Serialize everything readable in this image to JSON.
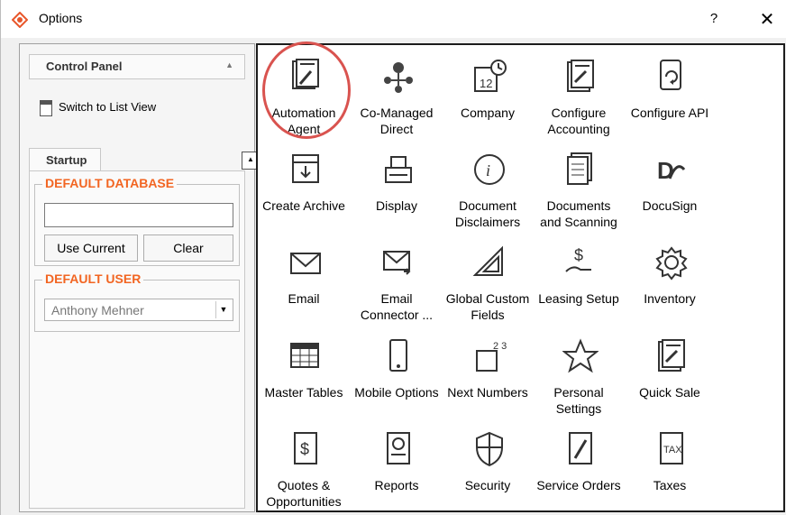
{
  "window": {
    "title": "Options",
    "help_label": "?",
    "close_label": "✕"
  },
  "left": {
    "control_panel": "Control Panel",
    "switch_view": "Switch to List View",
    "startup_tab": "Startup",
    "default_database": {
      "legend": "DEFAULT DATABASE",
      "value": "",
      "use_current": "Use Current",
      "clear": "Clear"
    },
    "default_user": {
      "legend": "DEFAULT USER",
      "selected": "Anthony Mehner"
    }
  },
  "accent_color": "#f26522",
  "highlight_color": "#d9534f",
  "tiles": [
    {
      "label1": "Automation",
      "label2": "Agent",
      "icon": "automation-agent-icon"
    },
    {
      "label1": "Co-Managed",
      "label2": "Direct",
      "icon": "network-icon"
    },
    {
      "label1": "Company",
      "label2": "",
      "icon": "calendar-clock-icon"
    },
    {
      "label1": "Configure",
      "label2": "Accounting",
      "icon": "ledger-icon"
    },
    {
      "label1": "Configure API",
      "label2": "",
      "icon": "api-sync-icon"
    },
    {
      "label1": "Create Archive",
      "label2": "",
      "icon": "archive-icon"
    },
    {
      "label1": "Display",
      "label2": "",
      "icon": "register-icon"
    },
    {
      "label1": "Document",
      "label2": "Disclaimers",
      "icon": "info-icon"
    },
    {
      "label1": "Documents",
      "label2": "and Scanning",
      "icon": "documents-icon"
    },
    {
      "label1": "DocuSign",
      "label2": "",
      "icon": "docusign-icon"
    },
    {
      "label1": "Email",
      "label2": "",
      "icon": "envelope-icon"
    },
    {
      "label1": "Email",
      "label2": "Connector ...",
      "icon": "email-connector-icon"
    },
    {
      "label1": "Global Custom",
      "label2": "Fields",
      "icon": "drafting-icon"
    },
    {
      "label1": "Leasing Setup",
      "label2": "",
      "icon": "money-hand-icon"
    },
    {
      "label1": "Inventory",
      "label2": "",
      "icon": "gear-icon"
    },
    {
      "label1": "Master Tables",
      "label2": "",
      "icon": "table-icon"
    },
    {
      "label1": "Mobile Options",
      "label2": "",
      "icon": "mobile-icon"
    },
    {
      "label1": "Next Numbers",
      "label2": "",
      "icon": "numbers-icon"
    },
    {
      "label1": "Personal",
      "label2": "Settings",
      "icon": "star-icon"
    },
    {
      "label1": "Quick Sale",
      "label2": "",
      "icon": "quick-sale-icon"
    },
    {
      "label1": "Quotes &",
      "label2": "Opportunities",
      "icon": "quote-dollar-icon"
    },
    {
      "label1": "Reports",
      "label2": "",
      "icon": "report-icon"
    },
    {
      "label1": "Security",
      "label2": "",
      "icon": "shield-icon"
    },
    {
      "label1": "Service Orders",
      "label2": "",
      "icon": "service-wrench-icon"
    },
    {
      "label1": "Taxes",
      "label2": "",
      "icon": "tax-icon"
    }
  ]
}
